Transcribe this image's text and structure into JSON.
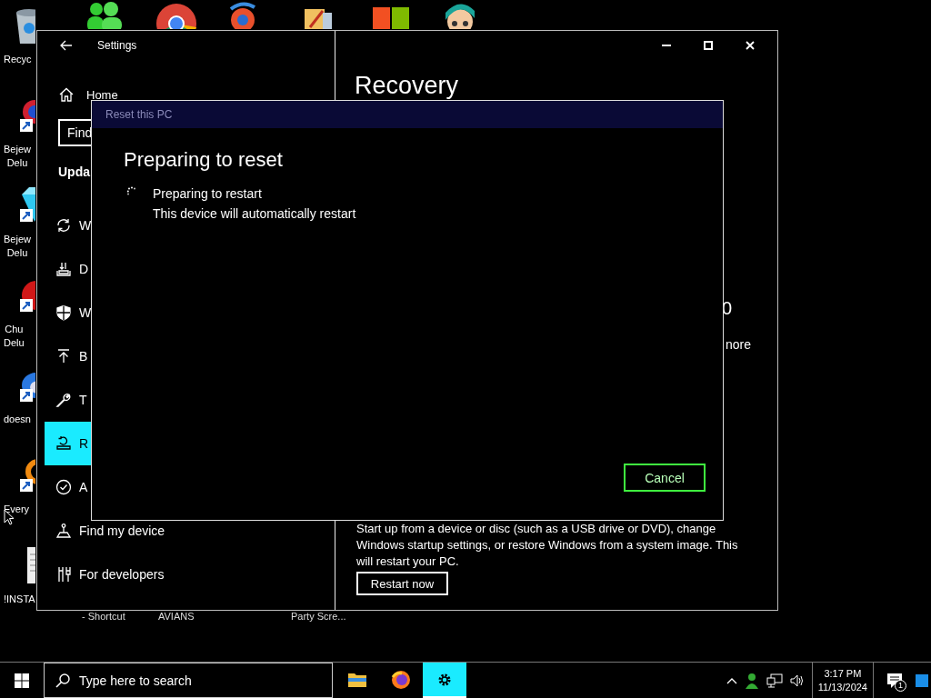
{
  "desktop": {
    "icons": [
      {
        "kind": "bin",
        "label": [
          "Recyc"
        ]
      },
      {
        "kind": "gem",
        "label": [
          "Bejew",
          "Delu"
        ]
      },
      {
        "kind": "diamond",
        "label": [
          "Bejew",
          "Delu"
        ]
      },
      {
        "kind": "creature",
        "label": [
          "Chu",
          "Delu"
        ]
      },
      {
        "kind": "bird",
        "label": [
          "doesn"
        ]
      },
      {
        "kind": "ring",
        "label": [
          "Every"
        ]
      },
      {
        "kind": "document",
        "label": [
          "!INSTA"
        ]
      }
    ],
    "bottom_labels": [
      "- Shortcut",
      "AVIANS",
      "Party Scre..."
    ]
  },
  "settings": {
    "title": "Settings",
    "home": "Home",
    "search_placeholder": "Find",
    "section": "Upda",
    "nav": [
      {
        "kind": "sync",
        "label": "W",
        "selected": false
      },
      {
        "kind": "delivery",
        "label": "D",
        "selected": false
      },
      {
        "kind": "shield",
        "label": "W",
        "selected": false
      },
      {
        "kind": "backup",
        "label": "B",
        "selected": false
      },
      {
        "kind": "wrench",
        "label": "T",
        "selected": false
      },
      {
        "kind": "recovery",
        "label": "R",
        "selected": true
      },
      {
        "kind": "check",
        "label": "A",
        "selected": false
      },
      {
        "kind": "find",
        "label": "Find my device",
        "selected": false
      },
      {
        "kind": "developers",
        "label": "For developers",
        "selected": false
      }
    ],
    "content": {
      "title": "Recovery",
      "fragments": [
        "0",
        "nore"
      ],
      "description": "Start up from a device or disc (such as a USB drive or DVD), change Windows startup settings, or restore Windows from a system image. This will restart your PC.",
      "button": "Restart now"
    }
  },
  "dialog": {
    "title": "Reset this PC",
    "heading": "Preparing to reset",
    "status": "Preparing to restart",
    "detail": "This device will automatically restart",
    "cancel": "Cancel"
  },
  "taskbar": {
    "search_placeholder": "Type here to search",
    "apps": [
      {
        "kind": "folder",
        "active": false
      },
      {
        "kind": "firefox",
        "active": false
      },
      {
        "kind": "settings",
        "active": true
      }
    ],
    "time": "3:17 PM",
    "date": "11/13/2024",
    "notifications": "1"
  }
}
